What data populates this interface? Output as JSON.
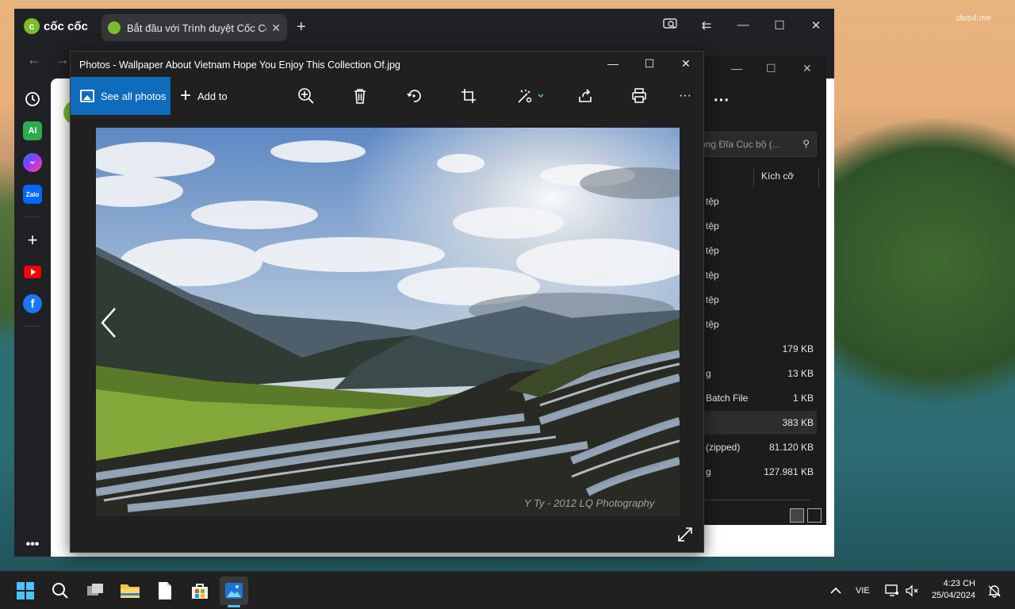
{
  "desktop": {
    "watermark": "dws4.me"
  },
  "browser": {
    "brand": "cốc cốc",
    "tab_title": "Bắt đầu với Trình duyệt Cốc Cốc",
    "tab_close": "✕",
    "new_tab": "+",
    "sidebar": {
      "ai_label": "AI",
      "zalo_label": "Zalo"
    }
  },
  "explorer": {
    "search_placeholder": "rong Đĩa Cục bộ (...",
    "col_size": "Kích cỡ",
    "rows": [
      {
        "type": "tệp",
        "size": ""
      },
      {
        "type": "tệp",
        "size": ""
      },
      {
        "type": "tệp",
        "size": ""
      },
      {
        "type": "tệp",
        "size": ""
      },
      {
        "type": "tệp",
        "size": ""
      },
      {
        "type": "tệp",
        "size": ""
      },
      {
        "type": "",
        "size": "179 KB"
      },
      {
        "type": "g",
        "size": "13 KB"
      },
      {
        "type": "Batch File",
        "size": "1 KB"
      },
      {
        "type": "",
        "size": "383 KB"
      },
      {
        "type": "(zipped)",
        "size": "81.120 KB"
      },
      {
        "type": "g",
        "size": "127.981 KB"
      }
    ]
  },
  "photos": {
    "title": "Photos - Wallpaper About Vietnam Hope You Enjoy This Collection Of.jpg",
    "see_all": "See all photos",
    "add_to": "Add to",
    "more": "···",
    "watermark": "Y Ty - 2012 LQ Photography"
  },
  "taskbar": {
    "language": "VIE",
    "time": "4:23 CH",
    "date": "25/04/2024"
  },
  "colors": {
    "accent": "#0f6cbd",
    "browser_brand": "#7cbd2c",
    "taskbar": "#202020"
  }
}
